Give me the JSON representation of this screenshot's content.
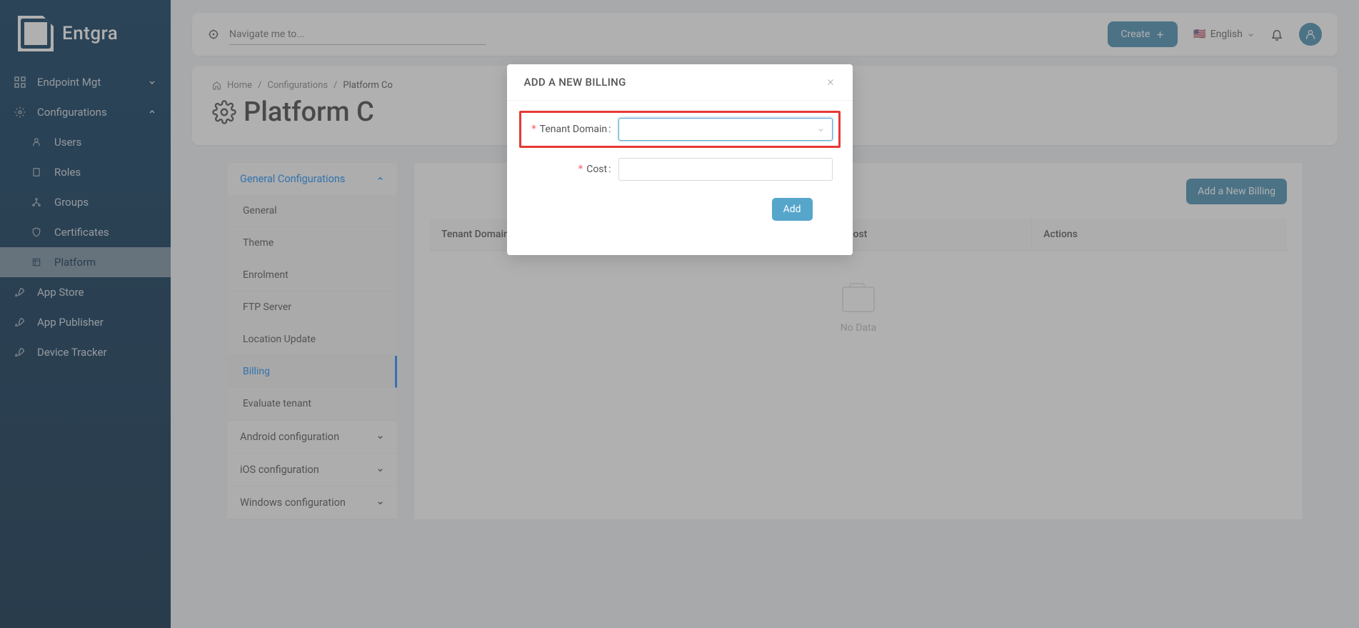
{
  "brand": "Entgra",
  "sidebar": {
    "items": [
      {
        "label": "Endpoint Mgt",
        "expanded": false
      },
      {
        "label": "Configurations",
        "expanded": true,
        "children": [
          {
            "label": "Users"
          },
          {
            "label": "Roles"
          },
          {
            "label": "Groups"
          },
          {
            "label": "Certificates"
          },
          {
            "label": "Platform",
            "active": true
          }
        ]
      },
      {
        "label": "App Store"
      },
      {
        "label": "App Publisher"
      },
      {
        "label": "Device Tracker"
      }
    ]
  },
  "topbar": {
    "navigate_placeholder": "Navigate me to...",
    "create_label": "Create",
    "language": "English"
  },
  "breadcrumb": {
    "home": "Home",
    "configs": "Configurations",
    "current": "Platform Co"
  },
  "page_title": "Platform C",
  "left_panel": {
    "sections": [
      {
        "label": "General Configurations",
        "open": true,
        "items": [
          {
            "label": "General"
          },
          {
            "label": "Theme"
          },
          {
            "label": "Enrolment"
          },
          {
            "label": "FTP Server"
          },
          {
            "label": "Location Update"
          },
          {
            "label": "Billing",
            "selected": true
          },
          {
            "label": "Evaluate tenant"
          }
        ]
      },
      {
        "label": "Android configuration",
        "open": false
      },
      {
        "label": "iOS configuration",
        "open": false
      },
      {
        "label": "Windows configuration",
        "open": false
      }
    ]
  },
  "right_panel": {
    "add_button": "Add a New Billing",
    "columns": [
      "Tenant Domain",
      "Cost",
      "Actions"
    ],
    "empty_text": "No Data"
  },
  "modal": {
    "title": "ADD A NEW BILLING",
    "tenant_label": "Tenant Domain",
    "cost_label": "Cost",
    "add_label": "Add"
  }
}
